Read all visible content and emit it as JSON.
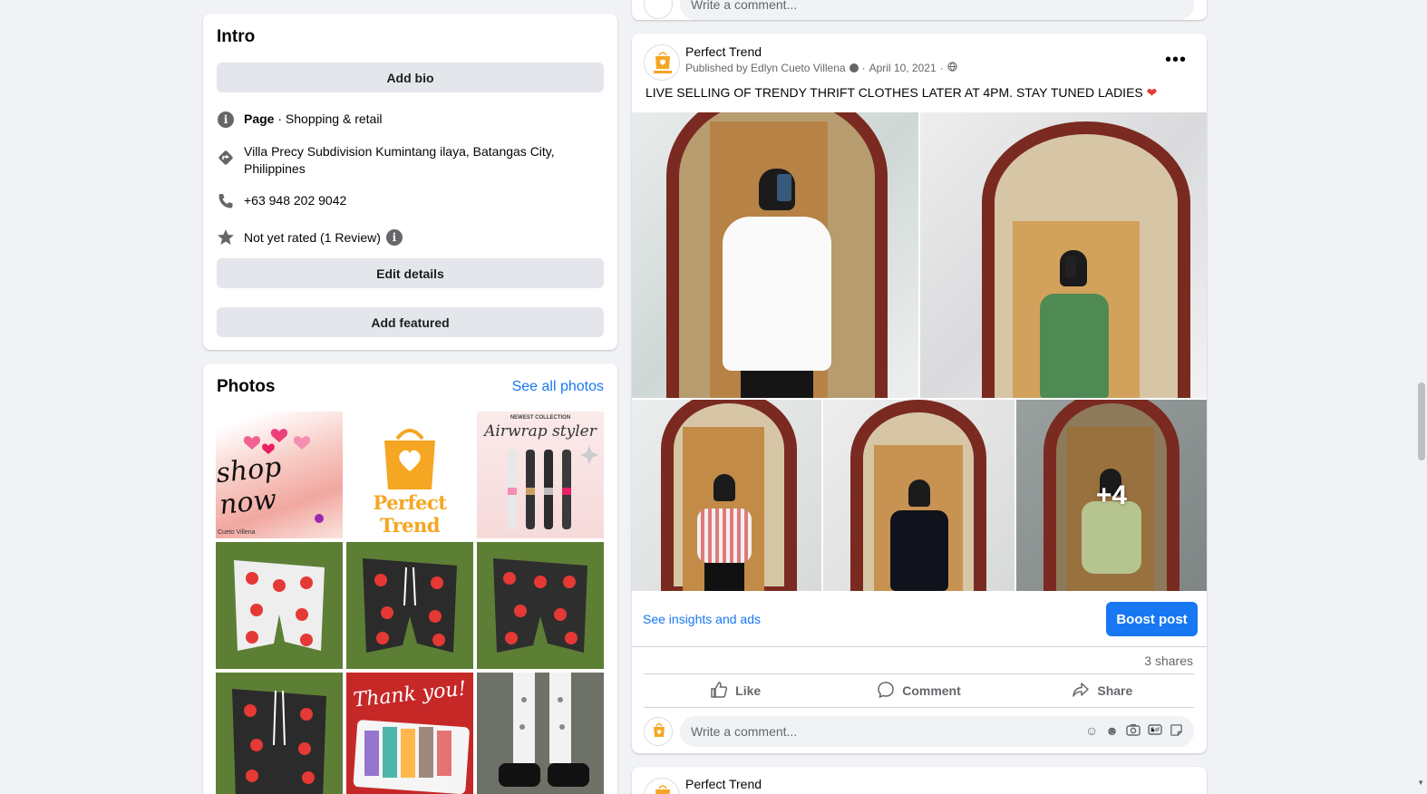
{
  "intro": {
    "title": "Intro",
    "add_bio": "Add bio",
    "page_label": "Page",
    "page_category": " · Shopping & retail",
    "address": "Villa Precy Subdivision Kumintang ilaya, Batangas City, Philippines",
    "phone": "+63 948 202 9042",
    "rating": "Not yet rated (1 Review)",
    "edit_details": "Edit details",
    "add_featured": "Add featured"
  },
  "photos": {
    "title": "Photos",
    "see_all": "See all photos",
    "tile_text": {
      "shop_now": "shop now",
      "shop_now_credit": "Cueto Villena",
      "brand": "Perfect Trend",
      "collection": "NEWEST COLLECTION",
      "collection_name": "Airwrap styler",
      "thank_you": "Thank you!"
    }
  },
  "prev_post": {
    "comment_placeholder": "Write a comment..."
  },
  "post": {
    "page_name": "Perfect Trend",
    "published_by": "Published by Edlyn Cueto Villena",
    "date": "April 10, 2021",
    "text": "LIVE SELLING OF TRENDY THRIFT CLOTHES LATER AT 4PM.  STAY TUNED LADIES",
    "more_photos": "+4",
    "insights": "See insights and ads",
    "boost": "Boost post",
    "shares": "3 shares",
    "like": "Like",
    "comment": "Comment",
    "share": "Share",
    "comment_placeholder": "Write a comment..."
  },
  "next_post": {
    "page_name": "Perfect Trend"
  },
  "colors": {
    "accent": "#1877f2",
    "brand_orange": "#f5a623",
    "mirror_frame": "#7a2a20"
  }
}
